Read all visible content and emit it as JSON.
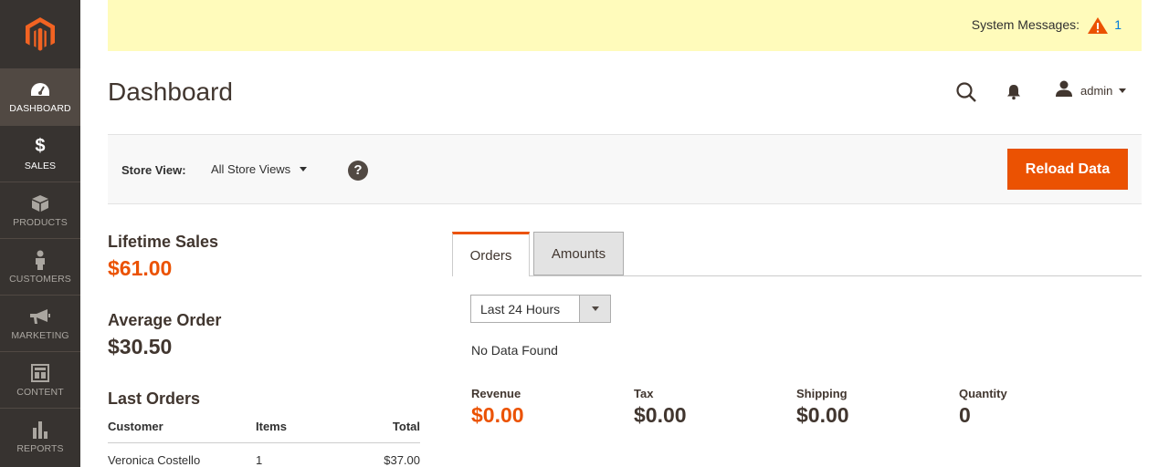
{
  "sidebar": {
    "items": [
      {
        "label": "Dashboard",
        "icon": "dashboard-icon"
      },
      {
        "label": "$",
        "icon": "dollar-icon"
      },
      {
        "label": "Sales",
        "icon": "dollar-icon"
      },
      {
        "label": "Products",
        "icon": "box-icon"
      },
      {
        "label": "Customers",
        "icon": "person-icon"
      },
      {
        "label": "Marketing",
        "icon": "megaphone-icon"
      },
      {
        "label": "Content",
        "icon": "layout-icon"
      },
      {
        "label": "Reports",
        "icon": "bar-chart-icon"
      }
    ]
  },
  "system_messages": {
    "label": "System Messages:",
    "count": "1"
  },
  "header": {
    "title": "Dashboard",
    "user": "admin"
  },
  "toolbar": {
    "store_view_label": "Store View:",
    "store_view_value": "All Store Views",
    "help": "?",
    "reload_label": "Reload Data"
  },
  "stats": {
    "lifetime_sales_label": "Lifetime Sales",
    "lifetime_sales_value": "$61.00",
    "average_order_label": "Average Order",
    "average_order_value": "$30.50"
  },
  "last_orders": {
    "title": "Last Orders",
    "columns": [
      "Customer",
      "Items",
      "Total"
    ],
    "rows": [
      {
        "customer": "Veronica Costello",
        "items": "1",
        "total": "$37.00"
      }
    ]
  },
  "tabs": [
    {
      "label": "Orders",
      "active": true
    },
    {
      "label": "Amounts",
      "active": false
    }
  ],
  "chart_panel": {
    "period": "Last 24 Hours",
    "no_data": "No Data Found",
    "metrics": [
      {
        "label": "Revenue",
        "value": "$0.00"
      },
      {
        "label": "Tax",
        "value": "$0.00"
      },
      {
        "label": "Shipping",
        "value": "$0.00"
      },
      {
        "label": "Quantity",
        "value": "0"
      }
    ]
  },
  "colors": {
    "accent": "#eb5202",
    "sidebar": "#373330",
    "sidebar_active": "#514943",
    "sysbar": "#fffbbb",
    "link": "#007bdb"
  }
}
